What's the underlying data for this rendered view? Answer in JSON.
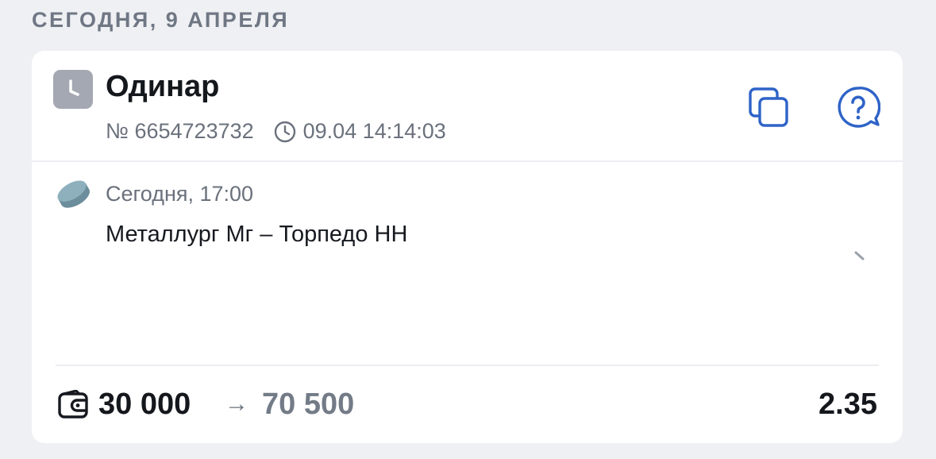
{
  "date_header": "СЕГОДНЯ, 9 АПРЕЛЯ",
  "bet": {
    "type": "Одинар",
    "status_icon": "clock-icon",
    "number": "№ 6654723732",
    "placed_at": "09.04 14:14:03",
    "actions": {
      "copy_icon": "copy-icon",
      "help_icon": "help-chat-icon"
    }
  },
  "event": {
    "sport_icon": "hockey-puck-icon",
    "time": "Сегодня, 17:00",
    "name": "Металлург Мг – Торпедо НН"
  },
  "footer": {
    "wallet_icon": "wallet-icon",
    "stake": "30 000",
    "arrow": "→",
    "payout": "70 500",
    "odds": "2.35"
  },
  "colors": {
    "background": "#eff0f3",
    "accent": "#2e63c7",
    "muted_text": "#6a717c",
    "status_badge": "#a3a8b2"
  }
}
